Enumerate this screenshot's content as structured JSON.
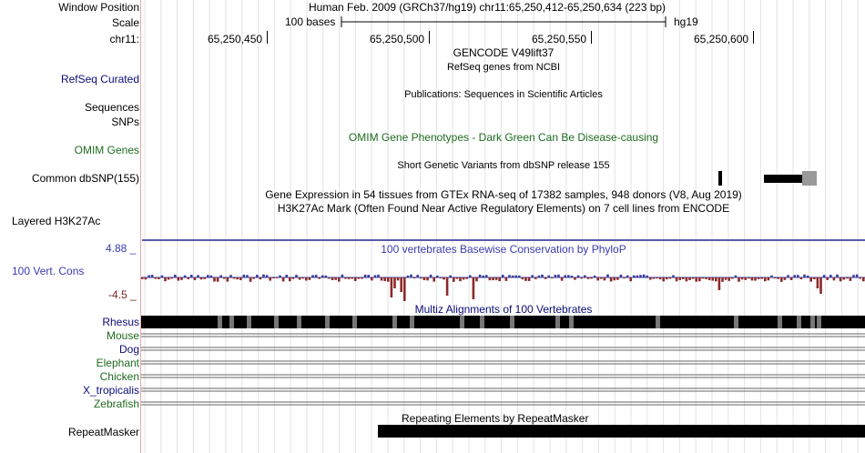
{
  "labels": {
    "window_position": "Window Position",
    "scale": "Scale",
    "chrom": "chr11:",
    "refseq": "RefSeq Curated",
    "sequences": "Sequences",
    "snps": "SNPs",
    "omim": "OMIM Genes",
    "dbsnp": "Common dbSNP(155)",
    "h3k27ac": "Layered H3K27Ac",
    "cons_max": "4.88 _",
    "cons_label": "100 Vert. Cons",
    "cons_min": "-4.5 _",
    "species": [
      "Rhesus",
      "Mouse",
      "Dog",
      "Elephant",
      "Chicken",
      "X_tropicalis",
      "Zebrafish"
    ],
    "repeatmasker": "RepeatMasker"
  },
  "header": {
    "position_text": "Human Feb. 2009 (GRCh37/hg19)   chr11:65,250,412-65,250,634 (223 bp)",
    "scale_text": "100 bases",
    "assembly": "hg19",
    "coordinates": [
      "65,250,450",
      "65,250,500",
      "65,250,550",
      "65,250,600"
    ]
  },
  "tracks": {
    "gencode_title": "GENCODE V49lift37",
    "refseq_title": "RefSeq genes from NCBI",
    "publications_title": "Publications: Sequences in Scientific Articles",
    "omim_title": "OMIM Gene Phenotypes - Dark Green Can Be Disease-causing",
    "dbsnp_title": "Short Genetic Variants from dbSNP release 155",
    "gtex_title": "Gene Expression in 54 tissues from GTEx RNA-seq of 17382 samples, 948 donors (V8, Aug 2019)",
    "h3k27ac_title": "H3K27Ac Mark (Often Found Near Active Regulatory Elements) on 7 cell lines from ENCODE",
    "cons_title": "100 vertebrates Basewise Conservation by PhyloP",
    "multiz_title": "Multiz Alignments of 100 Vertebrates",
    "rmsk_title": "Repeating Elements by RepeatMasker"
  },
  "colors": {
    "label_navy": "#0c0c78",
    "omim_green": "#1f6b1f",
    "cons_blue": "#3a3ab0",
    "cons_negative": "#8b2a2a",
    "cons_positive": "#3a3a9a",
    "left_border": "#e7a9a9"
  }
}
